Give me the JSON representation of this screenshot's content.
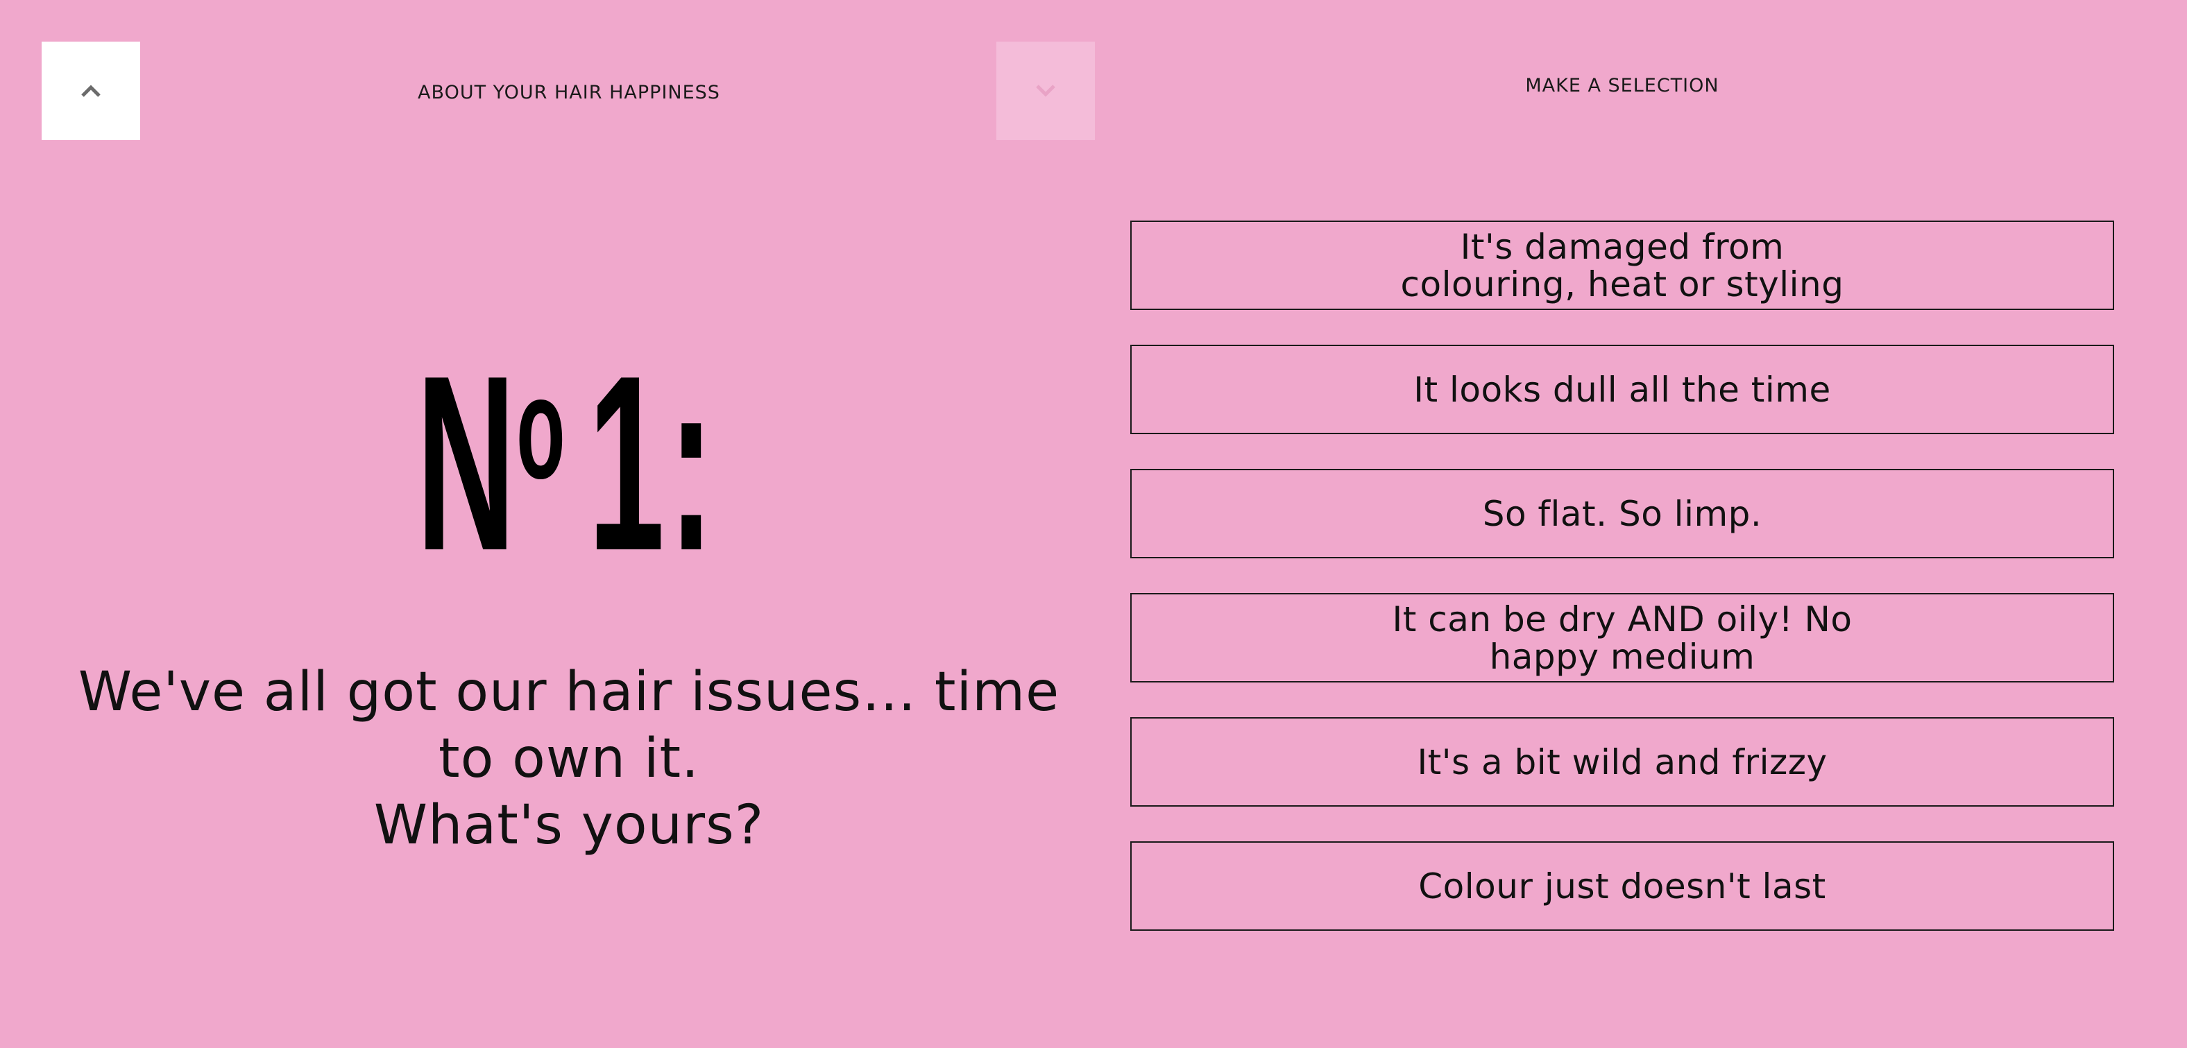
{
  "nav": {
    "up_icon": "chevron-up-icon",
    "down_icon": "chevron-down-icon"
  },
  "header": {
    "left_title": "ABOUT YOUR HAIR HAPPINESS",
    "right_title": "MAKE A SELECTION"
  },
  "question": {
    "badge_n": "N",
    "badge_o": "o",
    "badge_number": "1",
    "badge_colon": ":",
    "text_line1": "We've all got our hair issues… time",
    "text_line2": "to own it.",
    "text_line3": "What's yours?"
  },
  "options": [
    {
      "label": "It's damaged from colouring, heat or styling"
    },
    {
      "label": "It looks dull all the time"
    },
    {
      "label": "So flat. So limp."
    },
    {
      "label": "It can be dry AND oily! No happy medium"
    },
    {
      "label": "It's a bit wild and frizzy"
    },
    {
      "label": "Colour just doesn't last"
    }
  ],
  "colors": {
    "background": "#f0a8cc",
    "up_button": "#ffffff",
    "down_button": "#f4bcd9",
    "text": "#1a1a1a"
  }
}
